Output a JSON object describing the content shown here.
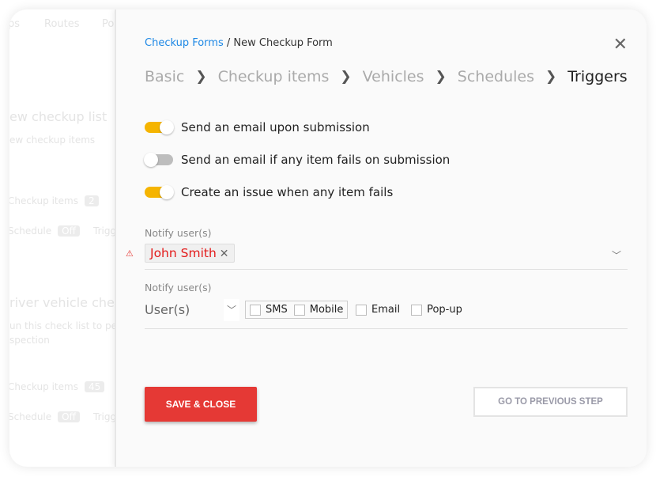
{
  "background": {
    "tabs": [
      "ps",
      "Routes",
      "Po"
    ],
    "lists": [
      {
        "title": "ew checkup list",
        "subtitle": "ew checkup items",
        "items_label": "Checkup items",
        "items_count": "2",
        "schedule_label": "Schedule",
        "schedule_value": "Off",
        "triggers_label": "Trigg"
      },
      {
        "title": "river vehicle check",
        "subtitle": "un this check list to perf",
        "subtitle2": "spection",
        "items_label": "Checkup items",
        "items_count": "45",
        "schedule_label": "Schedule",
        "schedule_value": "Off",
        "triggers_label": "Trigg"
      }
    ]
  },
  "breadcrumb": {
    "parent": "Checkup Forms",
    "separator": " / ",
    "current": "New Checkup Form"
  },
  "steps": [
    {
      "label": "Basic"
    },
    {
      "label": "Checkup items"
    },
    {
      "label": "Vehicles"
    },
    {
      "label": "Schedules"
    },
    {
      "label": "Triggers",
      "active": true
    }
  ],
  "toggles": [
    {
      "label": "Send an email upon submission",
      "on": true
    },
    {
      "label": "Send an email if any item fails on submission",
      "on": false
    },
    {
      "label": "Create an issue when any item fails",
      "on": true
    }
  ],
  "notify1": {
    "label": "Notify user(s)",
    "chip": "John Smith",
    "error": true
  },
  "notify2": {
    "label": "Notify user(s)",
    "placeholder": "User(s)",
    "channels": [
      {
        "label": "SMS",
        "checked": false
      },
      {
        "label": "Mobile",
        "checked": false
      },
      {
        "label": "Email",
        "checked": false
      },
      {
        "label": "Pop-up",
        "checked": false
      }
    ]
  },
  "buttons": {
    "save": "SAVE & CLOSE",
    "prev": "GO TO PREVIOUS STEP"
  },
  "colors": {
    "accent": "#f5b400",
    "danger": "#e53935",
    "link": "#1e88e5"
  }
}
